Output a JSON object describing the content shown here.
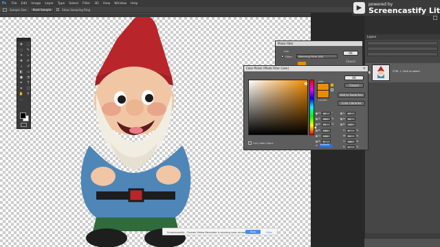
{
  "app": {
    "logo": "Ps"
  },
  "menu": [
    "File",
    "Edit",
    "Image",
    "Layer",
    "Type",
    "Select",
    "Filter",
    "3D",
    "View",
    "Window",
    "Help"
  ],
  "options_bar": {
    "sample_size_label": "Sample Size:",
    "sample_size_value": "Point Sample",
    "show_ring_label": "Show Sampling Ring"
  },
  "watermark": {
    "small": "powered by",
    "big": "Screencastify Lite",
    "logo_glyph": "▶"
  },
  "layers_panel": {
    "tab": "Layers",
    "layer_name": "CTRL + Click to select"
  },
  "photo_filter": {
    "title": "Photo Filter",
    "use_label": "Use",
    "filter_label": "Filter:",
    "filter_value": "Warming Filter (85)",
    "ok": "OK",
    "cancel": "Cancel",
    "swatch_color": "#ec8a00"
  },
  "color_picker": {
    "title": "Color Picker (Photo Filter Color)",
    "new_label": "new",
    "current_label": "current",
    "ok": "OK",
    "cancel": "Cancel",
    "add_swatches": "Add to Swatches",
    "color_libraries": "Color Libraries",
    "only_web": "Only Web Colors",
    "hex_label": "#",
    "hex": "ec8a00",
    "fields_left": [
      {
        "label": "H:",
        "value": "35",
        "unit": "°",
        "selected": true
      },
      {
        "label": "S:",
        "value": "100",
        "unit": "%",
        "selected": false
      },
      {
        "label": "B:",
        "value": "93",
        "unit": "%",
        "selected": false
      },
      {
        "label": "R:",
        "value": "236",
        "unit": "",
        "selected": false
      },
      {
        "label": "G:",
        "value": "138",
        "unit": "",
        "selected": false
      },
      {
        "label": "B:",
        "value": "0",
        "unit": "",
        "selected": false
      }
    ],
    "fields_right": [
      {
        "label": "L:",
        "value": "67",
        "unit": ""
      },
      {
        "label": "a:",
        "value": "32",
        "unit": ""
      },
      {
        "label": "b:",
        "value": "120",
        "unit": ""
      },
      {
        "label": "C:",
        "value": "6",
        "unit": "%"
      },
      {
        "label": "M:",
        "value": "52",
        "unit": "%"
      },
      {
        "label": "Y:",
        "value": "100",
        "unit": "%"
      },
      {
        "label": "K:",
        "value": "1",
        "unit": "%"
      }
    ]
  },
  "share_bar": {
    "message": "Screencastify - Screen Video Recorder is sharing your screen.",
    "stop": "Stop sharing",
    "hide": "Hide"
  },
  "colors": {
    "accent_orange": "#ec8a00",
    "ps_blue": "#39a3ff",
    "link_blue": "#4b8af0"
  }
}
